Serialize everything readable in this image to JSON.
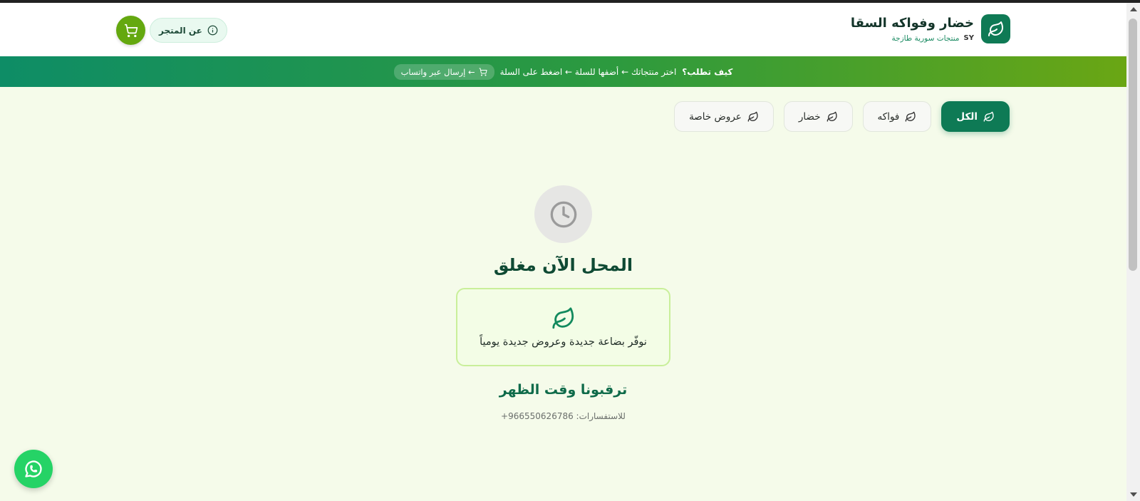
{
  "header": {
    "title": "خضار وفواكه السقا",
    "subtitle": "منتجات سورية طازجة",
    "country_code": "SY",
    "about_label": "عن المتجر"
  },
  "banner": {
    "lead": "كيف تطلب؟",
    "steps": "اختر منتجاتك ← أضفها للسلة ← اضغط على السلة",
    "pill": "← إرسال عبر واتساب"
  },
  "tabs": [
    {
      "label": "الكل",
      "active": true
    },
    {
      "label": "فواكه",
      "active": false
    },
    {
      "label": "خضار",
      "active": false
    },
    {
      "label": "عروض خاصة",
      "active": false
    }
  ],
  "closed": {
    "title": "المحل الآن مغلق",
    "info": "نوفّر بضاعة جديدة وعروض جديدة يومياً",
    "wait": "ترقبونا وقت الظهر",
    "contact": "للاستفسارات: 966550626786+"
  },
  "colors": {
    "primary": "#0e7a55",
    "accent": "#64a80f",
    "whatsapp": "#25d366",
    "background": "#f5fbea"
  },
  "icons": {
    "logo": "leaf-icon",
    "cart": "cart-icon",
    "about": "info-icon",
    "tab": "leaf-icon",
    "closed": "clock-icon",
    "info": "leaf-icon",
    "chat": "whatsapp-icon"
  }
}
